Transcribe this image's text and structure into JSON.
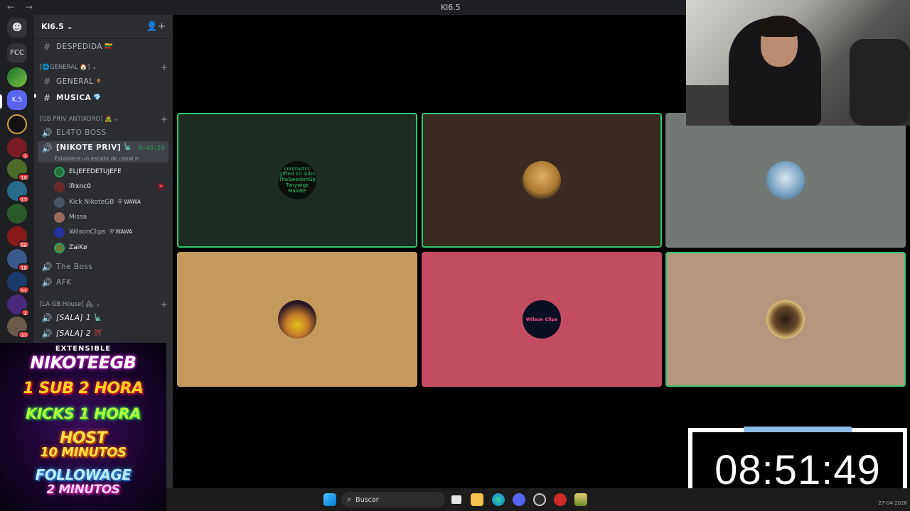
{
  "window": {
    "title": "Kl6.5",
    "nav": "← →"
  },
  "server_list": {
    "home_icon": "discord-icon",
    "folder_label": "FCC",
    "active_label": "K.5",
    "badges": [
      "1",
      "10",
      "17",
      "50",
      "18",
      "51",
      "1",
      "37"
    ]
  },
  "channel_sidebar": {
    "server_name": "Kl6.5",
    "invite_icon": "add-member-icon",
    "text_channels": [
      {
        "name": "DESPEDIDA",
        "emoji": "🇱🇹"
      },
      {
        "name": "GENERAL",
        "emoji": "⚜"
      },
      {
        "name": "MUSICA",
        "emoji": "💎"
      }
    ],
    "category_general": "[🌐GENERAL 🏠]",
    "category_gbpriv": "[GB PRIV ANTIXORO] 🧟",
    "category_lagb": "[LA GB House] 🏘",
    "voice_channels_top": [
      "EL4TO BOSS"
    ],
    "active_voice": {
      "name": "[NIKOTE PRIV]",
      "emoji": "🗽",
      "timer": "8:43:29",
      "status": "Establece un estado de canal ✏"
    },
    "voice_users": [
      {
        "name": "ELJEFEDETUJEFE",
        "tag": "",
        "muted": false,
        "color": "#2c6a3a"
      },
      {
        "name": "ifrxnc0",
        "tag": "",
        "muted": true,
        "color": "#6a2b2b"
      },
      {
        "name": "Kick NikoteGB",
        "tag": "⛨ WAWA",
        "muted": false,
        "color": "#4a5563"
      },
      {
        "name": "Missa",
        "tag": "",
        "muted": false,
        "color": "#9a6a5a"
      },
      {
        "name": "WilsonClips",
        "tag": "⛨ WAWA",
        "muted": false,
        "color": "#2230a0"
      },
      {
        "name": "ZaiKø",
        "tag": "",
        "muted": false,
        "color": "#6b7a3a"
      }
    ],
    "voice_channels_bottom": [
      "The Boss",
      "AFK"
    ],
    "lagb_channels": [
      {
        "name": "[SALA] 1",
        "emoji": "🗽"
      },
      {
        "name": "[SALA] 2",
        "emoji": "⛩"
      }
    ]
  },
  "promo": {
    "line0": "EXTENSIBLE",
    "line1": "NIKOTEEGB",
    "line2": "1 SUB 2 HORA",
    "line3": "KICKS 1 HORA",
    "line4": "HOST",
    "line5": "10 MINUTOS",
    "line6": "FOLLOWAGE",
    "line7": "2 MINUTOS"
  },
  "call_tiles": [
    {
      "bg": "#1e2b22",
      "speaking": true,
      "avatar_text": "contrastcc gifted 10 subs TheSwedishGp Tonywigz MaloEE",
      "avatar_bg": "#0b0f0c"
    },
    {
      "bg": "#3a2a22",
      "speaking": true,
      "avatar_text": "",
      "avatar_bg": "#c69a52"
    },
    {
      "bg": "#727975",
      "speaking": false,
      "avatar_text": "",
      "avatar_bg": "#7aa4c4"
    },
    {
      "bg": "#c49a5c",
      "speaking": false,
      "avatar_text": "",
      "avatar_bg": "#2a1624"
    },
    {
      "bg": "#c24d62",
      "speaking": false,
      "avatar_text": "Wilson Clips",
      "avatar_bg": "#0b0f22"
    },
    {
      "bg": "#b6977e",
      "speaking": true,
      "avatar_text": "",
      "avatar_bg": "#4a3a2a"
    }
  ],
  "stream_timer": "08:51:49",
  "taskbar": {
    "search_placeholder": "Buscar",
    "date": "27-04-2026",
    "icons": [
      "windows-start-icon",
      "task-view-icon",
      "file-explorer-icon",
      "edge-icon",
      "discord-icon",
      "steam-icon",
      "app-red-icon",
      "app-yellow-icon"
    ]
  }
}
